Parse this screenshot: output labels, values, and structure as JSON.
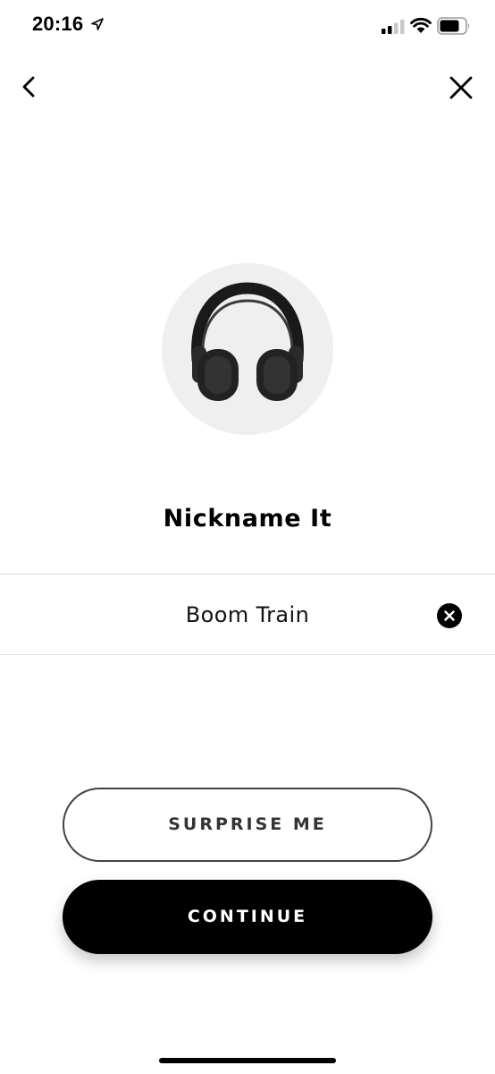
{
  "status_bar": {
    "time": "20:16",
    "location_icon": "location-arrow-icon",
    "signal_icon": "cellular-signal-icon",
    "wifi_icon": "wifi-icon",
    "battery_icon": "battery-icon"
  },
  "nav": {
    "back_icon": "chevron-left-icon",
    "close_icon": "close-icon"
  },
  "device": {
    "image_icon": "headphones-icon"
  },
  "page": {
    "title": "Nickname It"
  },
  "name_field": {
    "value": "Boom Train",
    "clear_icon": "clear-circle-icon"
  },
  "buttons": {
    "surprise_label": "SURPRISE ME",
    "continue_label": "CONTINUE"
  },
  "colors": {
    "primary": "#000000",
    "background": "#ffffff",
    "image_circle": "#efefef",
    "divider": "#dcdcdc"
  }
}
